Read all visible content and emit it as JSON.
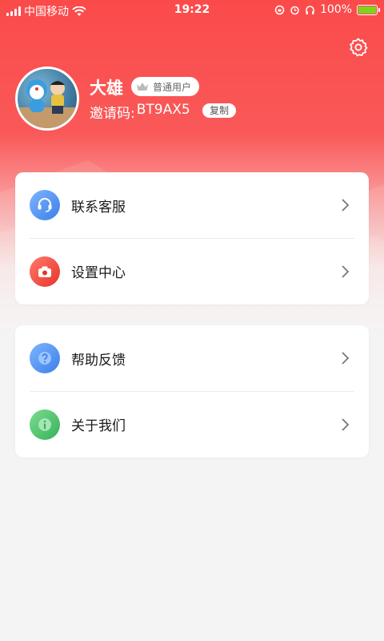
{
  "status_bar": {
    "carrier": "中国移动",
    "time": "19:22",
    "battery": "100%"
  },
  "profile": {
    "name": "大雄",
    "badge": "普通用户",
    "invite_label": "邀请码:",
    "invite_code": "BT9AX5",
    "copy_label": "复制"
  },
  "menu_group_1": [
    {
      "label": "联系客服",
      "icon": "headset-icon",
      "color": "#4a8ef0"
    },
    {
      "label": "设置中心",
      "icon": "camera-icon",
      "color": "#f2453d"
    }
  ],
  "menu_group_2": [
    {
      "label": "帮助反馈",
      "icon": "question-icon",
      "color": "#4a8ef0"
    },
    {
      "label": "关于我们",
      "icon": "info-icon",
      "color": "#47bf6a"
    }
  ],
  "colors": {
    "header": "#fb4a4a",
    "background": "#f4f4f4"
  }
}
